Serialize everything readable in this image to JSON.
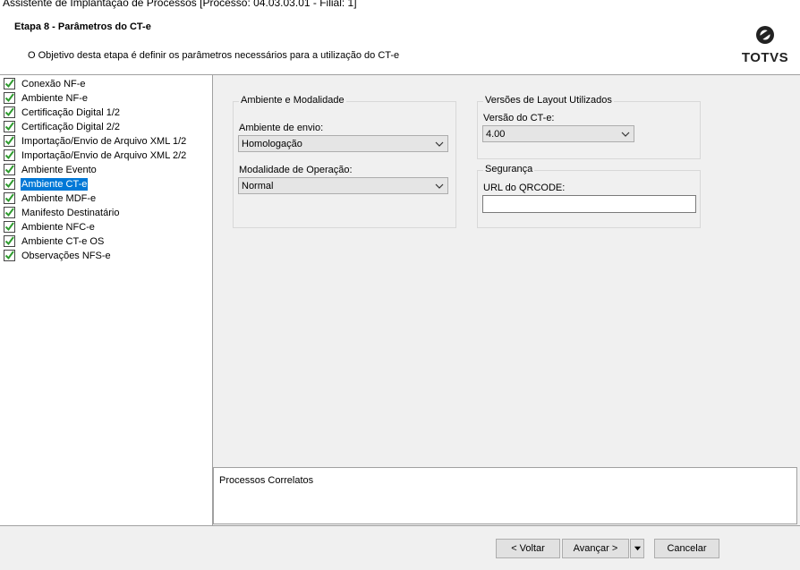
{
  "window": {
    "title": "Assistente de Implantação de Processos [Processo: 04.03.03.01 - Filial: 1]"
  },
  "header": {
    "step_title": "Etapa 8 - Parâmetros do CT-e",
    "description": "O Objetivo desta etapa é definir os parâmetros necessários para a utilização do CT-e",
    "logo_text": "TOTVS"
  },
  "sidebar": {
    "items": [
      {
        "label": "Conexão NF-e"
      },
      {
        "label": "Ambiente NF-e"
      },
      {
        "label": "Certificação Digital 1/2"
      },
      {
        "label": "Certificação Digital 2/2"
      },
      {
        "label": "Importação/Envio de Arquivo XML 1/2"
      },
      {
        "label": "Importação/Envio de Arquivo XML 2/2"
      },
      {
        "label": "Ambiente Evento"
      },
      {
        "label": "Ambiente CT-e"
      },
      {
        "label": "Ambiente MDF-e"
      },
      {
        "label": "Manifesto Destinatário"
      },
      {
        "label": "Ambiente NFC-e"
      },
      {
        "label": "Ambiente CT-e OS"
      },
      {
        "label": "Observações NFS-e"
      }
    ],
    "selected": "Ambiente CT-e"
  },
  "groups": {
    "ambiente": {
      "title": "Ambiente e Modalidade",
      "envio_label": "Ambiente de envio:",
      "envio_value": "Homologação",
      "modalidade_label": "Modalidade de Operação:",
      "modalidade_value": "Normal"
    },
    "versoes": {
      "title": "Versões de Layout Utilizados",
      "versao_label": "Versão do CT-e:",
      "versao_value": "4.00"
    },
    "seguranca": {
      "title": "Segurança",
      "qrcode_label": "URL do QRCODE:",
      "qrcode_value": ""
    }
  },
  "related": {
    "label": "Processos Correlatos"
  },
  "buttons": {
    "back": "< Voltar",
    "next": "Avançar >",
    "cancel": "Cancelar"
  },
  "colors": {
    "selection": "#0078d7",
    "check_green": "#2e9b2e"
  }
}
